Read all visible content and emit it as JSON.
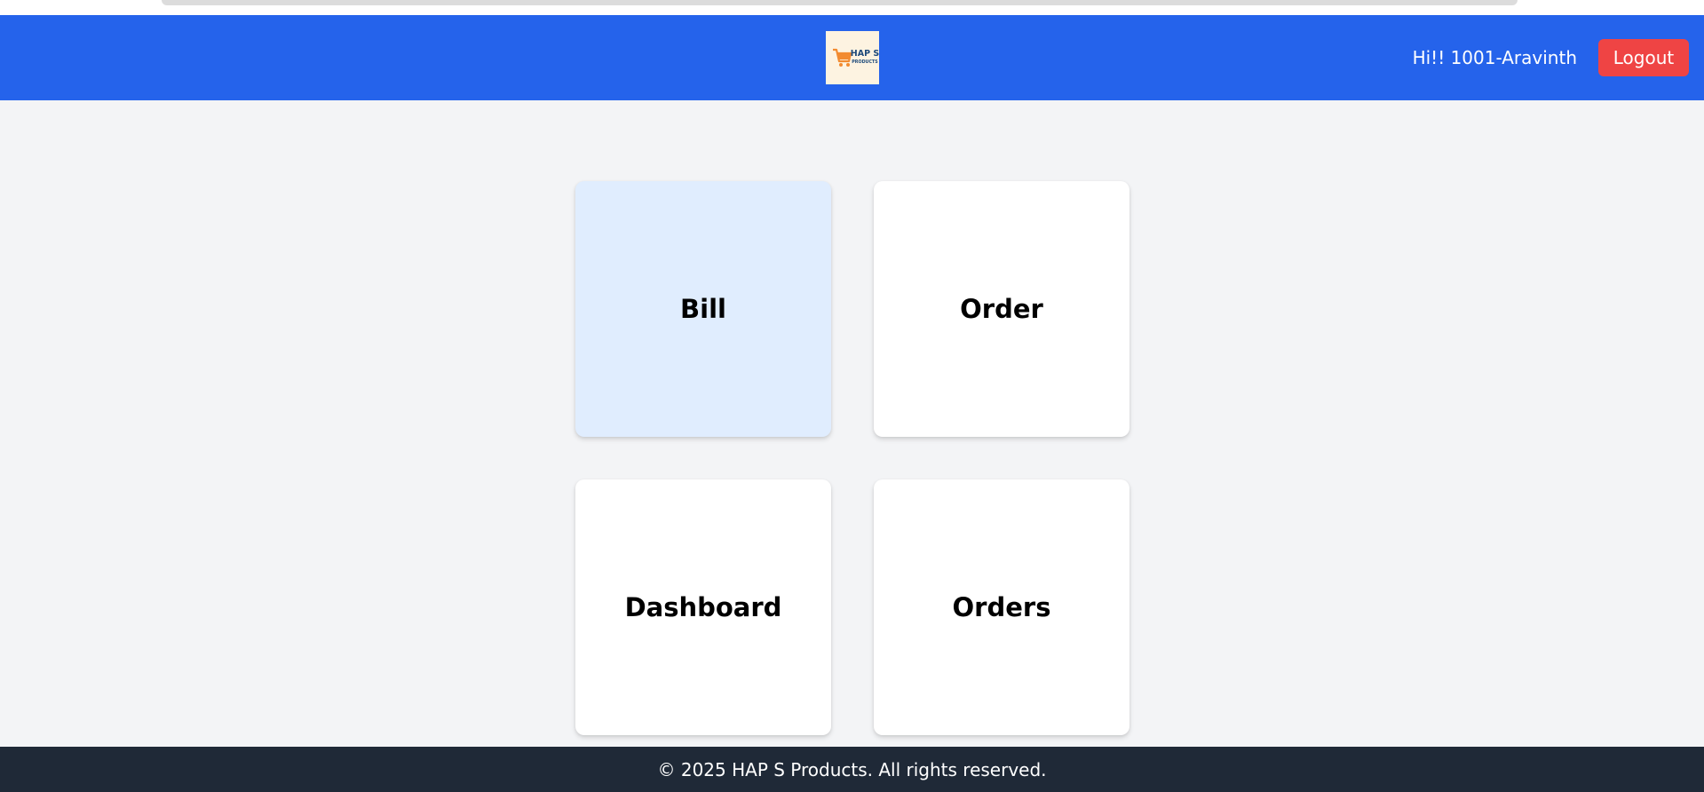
{
  "header": {
    "logo": {
      "line1": "HAP S",
      "line2": "PRODUCTS",
      "icon": "shopping-cart-icon",
      "background": "#fdf3e1",
      "text_color": "#1e4a7a",
      "icon_color": "#f28b30"
    },
    "greeting": "Hi!! 1001-Aravinth",
    "logout_label": "Logout",
    "background": "#2563eb",
    "logout_color": "#ef4444"
  },
  "cards": [
    {
      "label": "Bill",
      "active": true
    },
    {
      "label": "Order",
      "active": false
    },
    {
      "label": "Dashboard",
      "active": false
    },
    {
      "label": "Orders",
      "active": false
    }
  ],
  "footer": {
    "text": "© 2025 HAP S Products. All rights reserved.",
    "background": "#1f2937"
  }
}
